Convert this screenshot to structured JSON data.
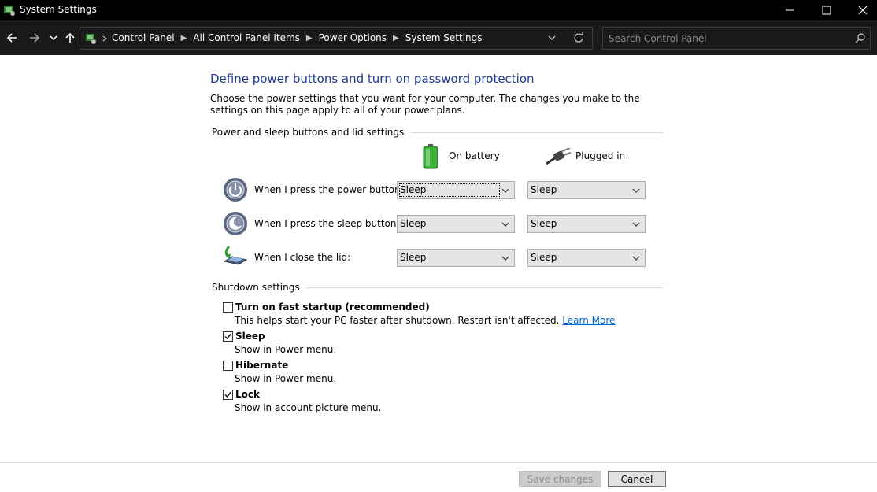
{
  "window": {
    "title": "System Settings"
  },
  "address": {
    "breadcrumbs": [
      "Control Panel",
      "All Control Panel Items",
      "Power Options",
      "System Settings"
    ]
  },
  "search": {
    "placeholder": "Search Control Panel"
  },
  "page": {
    "heading": "Define power buttons and turn on password protection",
    "description": "Choose the power settings that you want for your computer. The changes you make to the settings on this page apply to all of your power plans.",
    "power_group_label": "Power and sleep buttons and lid settings",
    "columns": {
      "battery": "On battery",
      "plugged": "Plugged in"
    },
    "rows": [
      {
        "label": "When I press the power button:",
        "battery": "Sleep",
        "plugged": "Sleep"
      },
      {
        "label": "When I press the sleep button:",
        "battery": "Sleep",
        "plugged": "Sleep"
      },
      {
        "label": "When I close the lid:",
        "battery": "Sleep",
        "plugged": "Sleep"
      }
    ],
    "shutdown_group_label": "Shutdown settings",
    "shutdown_options": [
      {
        "title": "Turn on fast startup (recommended)",
        "desc": "This helps start your PC faster after shutdown. Restart isn't affected.",
        "link": "Learn More",
        "checked": false
      },
      {
        "title": "Sleep",
        "desc": "Show in Power menu.",
        "checked": true
      },
      {
        "title": "Hibernate",
        "desc": "Show in Power menu.",
        "checked": false
      },
      {
        "title": "Lock",
        "desc": "Show in account picture menu.",
        "checked": true
      }
    ]
  },
  "footer": {
    "save_label": "Save changes",
    "cancel_label": "Cancel"
  },
  "colors": {
    "heading": "#1e3a96",
    "link": "#0066cc",
    "titlebar": "#000000",
    "navbar": "#191919"
  }
}
